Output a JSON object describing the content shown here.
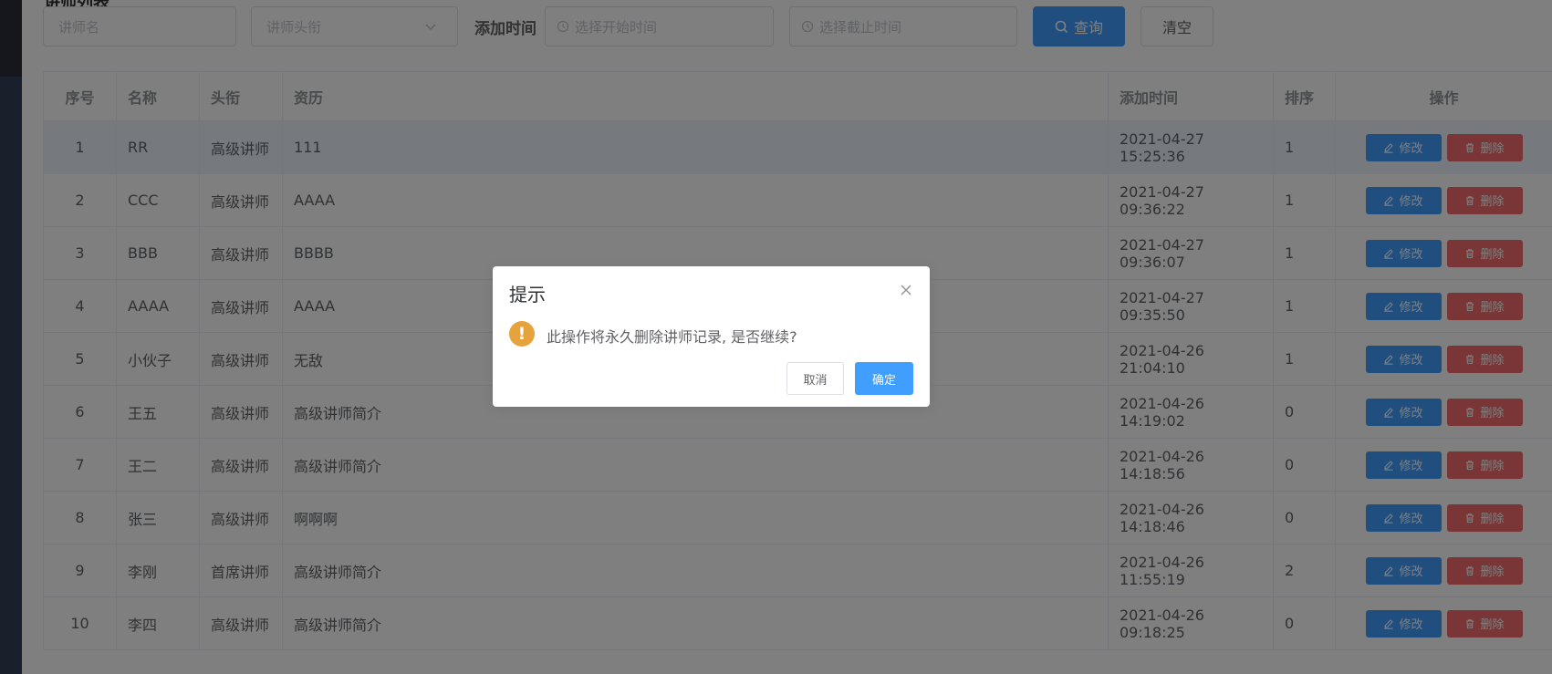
{
  "page": {
    "title": "讲师列表"
  },
  "filters": {
    "name_placeholder": "讲师名",
    "level_placeholder": "讲师头衔",
    "time_label": "添加时间",
    "start_placeholder": "选择开始时间",
    "end_placeholder": "选择截止时间",
    "query_label": "查询",
    "clear_label": "清空"
  },
  "table": {
    "headers": [
      "序号",
      "名称",
      "头衔",
      "资历",
      "添加时间",
      "排序",
      "操作"
    ],
    "edit_label": "修改",
    "delete_label": "删除",
    "rows": [
      {
        "idx": "1",
        "name": "RR",
        "level": "高级讲师",
        "intro": "111",
        "time": "2021-04-27 15:25:36",
        "sort": "1"
      },
      {
        "idx": "2",
        "name": "CCC",
        "level": "高级讲师",
        "intro": "AAAA",
        "time": "2021-04-27 09:36:22",
        "sort": "1"
      },
      {
        "idx": "3",
        "name": "BBB",
        "level": "高级讲师",
        "intro": "BBBB",
        "time": "2021-04-27 09:36:07",
        "sort": "1"
      },
      {
        "idx": "4",
        "name": "AAAA",
        "level": "高级讲师",
        "intro": "AAAA",
        "time": "2021-04-27 09:35:50",
        "sort": "1"
      },
      {
        "idx": "5",
        "name": "小伙子",
        "level": "高级讲师",
        "intro": "无敌",
        "time": "2021-04-26 21:04:10",
        "sort": "1"
      },
      {
        "idx": "6",
        "name": "王五",
        "level": "高级讲师",
        "intro": "高级讲师简介",
        "time": "2021-04-26 14:19:02",
        "sort": "0"
      },
      {
        "idx": "7",
        "name": "王二",
        "level": "高级讲师",
        "intro": "高级讲师简介",
        "time": "2021-04-26 14:18:56",
        "sort": "0"
      },
      {
        "idx": "8",
        "name": "张三",
        "level": "高级讲师",
        "intro": "啊啊啊",
        "time": "2021-04-26 14:18:46",
        "sort": "0"
      },
      {
        "idx": "9",
        "name": "李刚",
        "level": "首席讲师",
        "intro": "高级讲师简介",
        "time": "2021-04-26 11:55:19",
        "sort": "2"
      },
      {
        "idx": "10",
        "name": "李四",
        "level": "高级讲师",
        "intro": "高级讲师简介",
        "time": "2021-04-26 09:18:25",
        "sort": "0"
      }
    ]
  },
  "dialog": {
    "title": "提示",
    "message": "此操作将永久删除讲师记录, 是否继续?",
    "cancel_label": "取消",
    "ok_label": "确定"
  },
  "colors": {
    "primary": "#409eff",
    "danger": "#f56c6c",
    "warning": "#e6a23c",
    "sidebar": "#304156"
  },
  "icons": {
    "search": "search-icon",
    "clock": "clock-icon",
    "chevron": "chevron-down-icon",
    "edit": "edit-icon",
    "delete": "trash-icon",
    "close": "close-icon",
    "warning": "warning-icon"
  }
}
